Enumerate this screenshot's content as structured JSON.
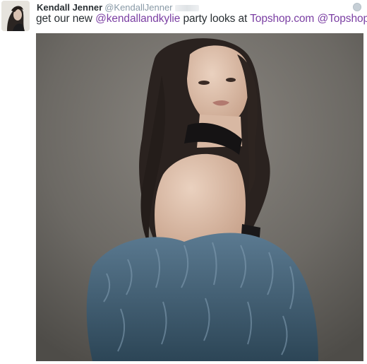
{
  "tweet": {
    "author_name": "Kendall Jenner",
    "author_handle": "@KendallJenner",
    "text_prefix": "get our new ",
    "mention_1": "@kendallandkylie",
    "text_middle": " party looks at ",
    "link": "Topshop.com",
    "text_space": " ",
    "mention_2": "@Topshop"
  },
  "icons": {
    "avatar": "profile-photo",
    "globe": "globe-icon"
  },
  "colors": {
    "mention": "#7b3fa3",
    "name": "#292f33",
    "handle": "#8899a6"
  }
}
